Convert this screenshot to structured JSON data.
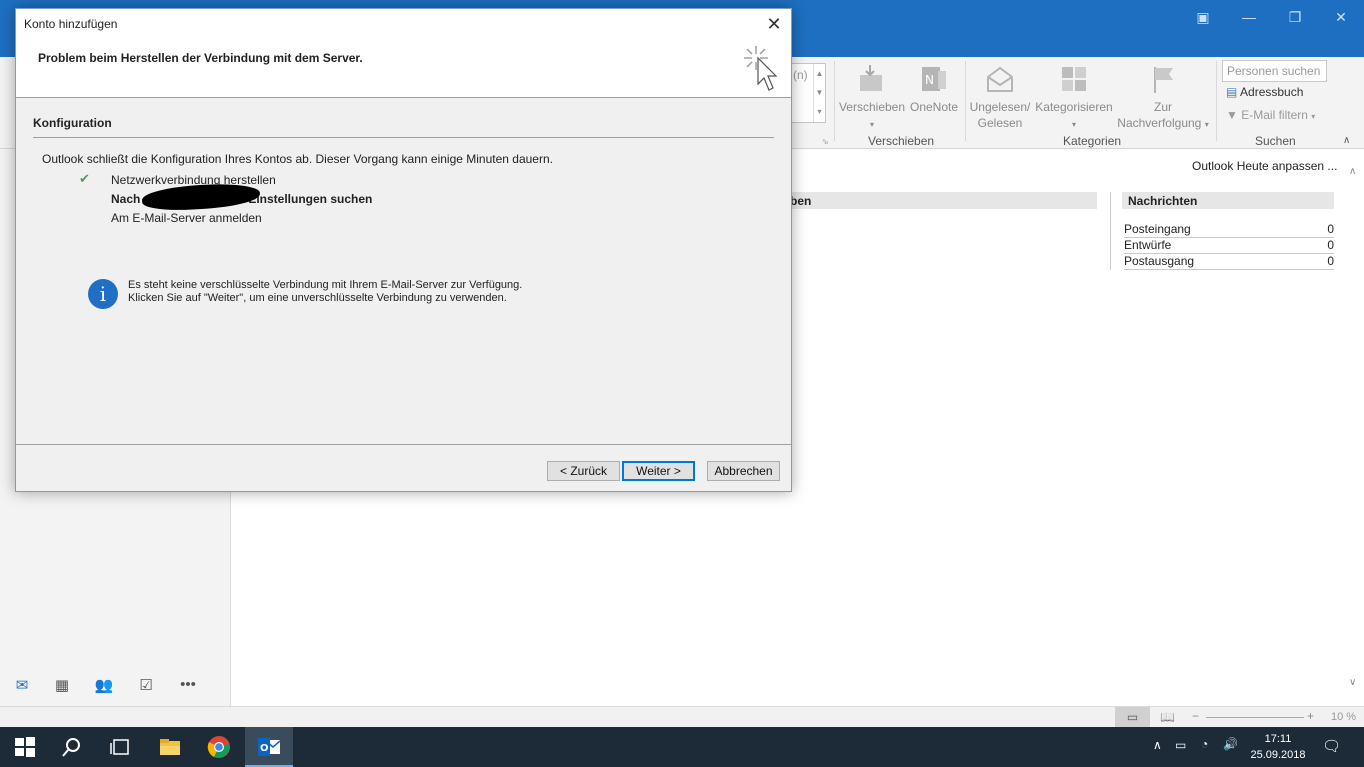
{
  "outlook": {
    "ribbon": {
      "move_label": "Verschieben",
      "onenote_label": "OneNote",
      "move_group": "Verschieben",
      "unread_label_1": "Ungelesen/",
      "unread_label_2": "Gelesen",
      "categorize_label": "Kategorisieren",
      "followup_label_1": "Zur",
      "followup_label_2": "Nachverfolgung",
      "categories_group": "Kategorien",
      "search_people_placeholder": "Personen suchen",
      "address_book": "Adressbuch",
      "email_filter": "E-Mail filtern",
      "search_group": "Suchen",
      "partial_label": "(n)"
    },
    "today": {
      "customize_link": "Outlook Heute anpassen ...",
      "left_column_header_partial": "ben",
      "messages_header": "Nachrichten",
      "rows": [
        {
          "label": "Posteingang",
          "count": "0"
        },
        {
          "label": "Entwürfe",
          "count": "0"
        },
        {
          "label": "Postausgang",
          "count": "0"
        }
      ]
    },
    "status": {
      "zoom": "10 %"
    }
  },
  "dialog": {
    "title": "Konto hinzufügen",
    "headline": "Problem beim Herstellen der Verbindung mit dem Server.",
    "section": "Konfiguration",
    "intro": "Outlook schließt die Konfiguration Ihres Kontos ab. Dieser Vorgang kann einige Minuten dauern.",
    "steps": [
      {
        "label": "Netzwerkverbindung herstellen",
        "done": true
      },
      {
        "label_prefix": "Nach",
        "label_suffix": "-Einstellungen suchen",
        "active": true
      },
      {
        "label": "Am E-Mail-Server anmelden"
      }
    ],
    "info_line1": "Es steht keine verschlüsselte Verbindung mit Ihrem E-Mail-Server zur Verfügung.",
    "info_line2": "Klicken Sie auf \"Weiter\", um eine unverschlüsselte Verbindung zu verwenden.",
    "buttons": {
      "back": "< Zurück",
      "next": "Weiter >",
      "cancel": "Abbrechen"
    }
  },
  "taskbar": {
    "time": "17:11",
    "date": "25.09.2018"
  },
  "colors": {
    "accent": "#1e6fc1",
    "taskbar": "#1d2b38",
    "info": "#1f6fc6"
  }
}
